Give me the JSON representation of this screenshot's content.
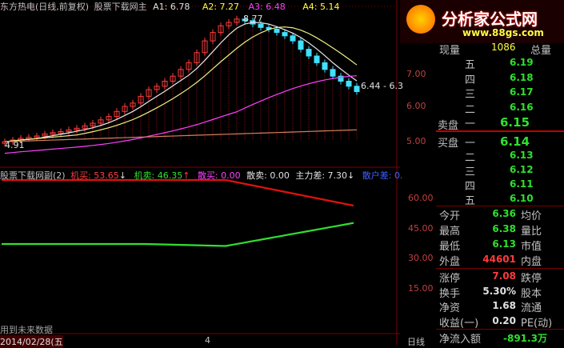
{
  "colors": {
    "up": "#ff3b3b",
    "down": "#2ee02e",
    "bg": "#000000",
    "grid": "#7a0000",
    "ma1": "#e8e8e8",
    "ma2": "#f0f080",
    "ma3": "#ff40ff",
    "ma4": "#d08060"
  },
  "top_bar": {
    "title": "东方热电(日线,前复权)",
    "indicator": "股票下载网主",
    "a1": "A1: 6.78",
    "a2": "A2: 7.27",
    "a3": "A3: 6.48",
    "a4": "A4: 5.14"
  },
  "main_chart": {
    "high_label": "8.77",
    "low_label": "4.91",
    "last_label": "6.44 - 6.3",
    "y_ticks": [
      "7.00",
      "6.00",
      "5.00"
    ]
  },
  "sub_bar": {
    "title": "股票下载网副(2)",
    "jimai": "机买: 53.65",
    "jimai_arrow": "↓",
    "jimai2": "机卖: 46.35",
    "jimai2_arrow": "↑",
    "sanmai": "散买: 0.00",
    "sanmai2": "散卖: 0.00",
    "zhuli": "主力差: 7.30",
    "zhuli_arrow": "↓",
    "sanhu": "散户差: 0."
  },
  "sub_chart": {
    "y_ticks": [
      "60.00",
      "45.00",
      "30.00",
      "15.00"
    ]
  },
  "bottom": {
    "left_text": "用到未来数据",
    "date": "2014/02/28(五",
    "mark": "4",
    "period": "日线"
  },
  "logo": {
    "name": "分析家公式网",
    "url": "www.88gs.com"
  },
  "quote": {
    "xianliang_label": "现量",
    "xianliang_value": "1086",
    "zongliang_label": "总量",
    "asks": [
      {
        "label": "五",
        "value": "6.19"
      },
      {
        "label": "四",
        "value": "6.18"
      },
      {
        "label": "三",
        "value": "6.17"
      },
      {
        "label": "二",
        "value": "6.16"
      },
      {
        "label": "一",
        "value": "6.15"
      }
    ],
    "sell_label": "卖盘",
    "buy_label": "买盘",
    "bids": [
      {
        "label": "一",
        "value": "6.14"
      },
      {
        "label": "二",
        "value": "6.13"
      },
      {
        "label": "三",
        "value": "6.12"
      },
      {
        "label": "四",
        "value": "6.11"
      },
      {
        "label": "五",
        "value": "6.10"
      }
    ],
    "stats": [
      {
        "l1": "今开",
        "v1": "6.36",
        "l2": "均价"
      },
      {
        "l1": "最高",
        "v1": "6.38",
        "l2": "量比"
      },
      {
        "l1": "最低",
        "v1": "6.13",
        "l2": "市值"
      },
      {
        "l1": "外盘",
        "v1": "44601",
        "l2": "内盘"
      }
    ],
    "stats2": [
      {
        "l1": "涨停",
        "v1": "7.08",
        "l2": "跌停"
      },
      {
        "l1": "换手",
        "v1": "5.30%",
        "l2": "股本"
      },
      {
        "l1": "净资",
        "v1": "1.68",
        "l2": "流通"
      },
      {
        "l1": "收益(一)",
        "v1": "0.20",
        "l2": "PE(动)"
      }
    ],
    "net_label": "净流入额",
    "net_value": "-891.3万"
  }
}
